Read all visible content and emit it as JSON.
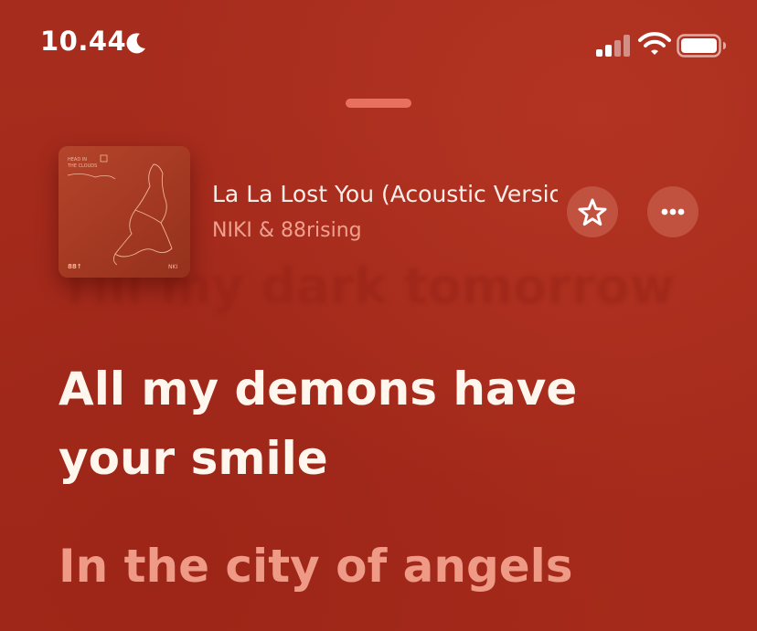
{
  "status_bar": {
    "time": "10.44",
    "moon_icon": "moon-icon",
    "signal_icon": "cellular-signal-icon",
    "wifi_icon": "wifi-icon",
    "battery_icon": "battery-icon"
  },
  "now_playing": {
    "title": "La La Lost You (Acoustic Version)",
    "artist": "NIKI & 88rising",
    "artwork_icon": "album-artwork",
    "favorite_icon": "star-icon",
    "more_icon": "more-icon"
  },
  "lyrics": {
    "previous_ghost": "Till my dark tomorrow",
    "current": "All my demons have your smile",
    "next": "In the city of angels"
  },
  "colors": {
    "background": "#a72b1c",
    "accent": "#ee9a86",
    "button": "#c0523f"
  }
}
